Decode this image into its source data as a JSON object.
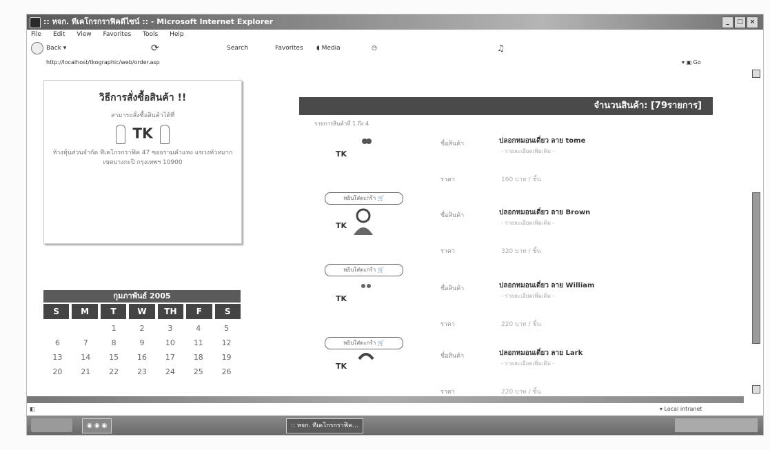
{
  "window": {
    "title": ":: หจก. ทีเคโกรกราฟิคดีไซน์ :: - Microsoft Internet Explorer"
  },
  "menu": [
    "File",
    "Edit",
    "View",
    "Favorites",
    "Tools",
    "Help"
  ],
  "toolbar": {
    "back": "Back",
    "search": "Search",
    "favorites": "Favorites",
    "media": "Media"
  },
  "address": {
    "url": "http://localhost/tkographic/web/order.asp",
    "go": "Go"
  },
  "howto": {
    "title": "วิธีการสั่งซื้อสินค้า !!",
    "intro": "สามารถสั่งซื้อสินค้าได้ที่",
    "logo": "TK",
    "address": "ห้างหุ้นส่วนจำกัด ทีเคโกรกราฟิค 47 ซอยรามคำแหง แขวงหัวหมาก เขตบางกะปิ กรุงเทพฯ 10900"
  },
  "calendar": {
    "title": "กุมภาพันธ์ 2005",
    "days_of_week": [
      "S",
      "M",
      "T",
      "W",
      "TH",
      "F",
      "S"
    ],
    "days": [
      "",
      "",
      "1",
      "2",
      "3",
      "4",
      "5",
      "6",
      "7",
      "8",
      "9",
      "10",
      "11",
      "12",
      "13",
      "14",
      "15",
      "16",
      "17",
      "18",
      "19",
      "20",
      "21",
      "22",
      "23",
      "24",
      "25",
      "26"
    ]
  },
  "products": {
    "header": "จำนวนสินค้า: [79รายการ]",
    "pager": "รายการสินค้าที่ 1 ถึง 4",
    "items": [
      {
        "tk": "TK",
        "label": "ชื่อสินค้า",
        "name": "ปลอกหมอนเดี่ยว ลาย tome",
        "desc": "- รายละเอียดเพิ่มเติม -",
        "price_label": "ราคา",
        "price": "160 บาท / ชิ้น",
        "button": "หยิบใส่ตะกร้า"
      },
      {
        "tk": "TK",
        "label": "ชื่อสินค้า",
        "name": "ปลอกหมอนเดี่ยว ลาย Brown",
        "desc": "- รายละเอียดเพิ่มเติม -",
        "price_label": "ราคา",
        "price": "320 บาท / ชิ้น",
        "button": "หยิบใส่ตะกร้า"
      },
      {
        "tk": "TK",
        "label": "ชื่อสินค้า",
        "name": "ปลอกหมอนเดี่ยว ลาย William",
        "desc": "- รายละเอียดเพิ่มเติม -",
        "price_label": "ราคา",
        "price": "220 บาท / ชิ้น",
        "button": "หยิบใส่ตะกร้า"
      },
      {
        "tk": "TK",
        "label": "ชื่อสินค้า",
        "name": "ปลอกหมอนเดี่ยว ลาย Lark",
        "desc": "- รายละเอียดเพิ่มเติม -",
        "price_label": "ราคา",
        "price": "220 บาท / ชิ้น",
        "button": "หยิบใส่ตะกร้า"
      }
    ]
  },
  "status": {
    "zone": "Local intranet"
  },
  "taskbar": {
    "active_window": ":: หจก. ทีเคโกรกราฟิค..."
  },
  "colors": {
    "header_bg": "#4a4a4a",
    "calendar_bg": "#444444"
  }
}
